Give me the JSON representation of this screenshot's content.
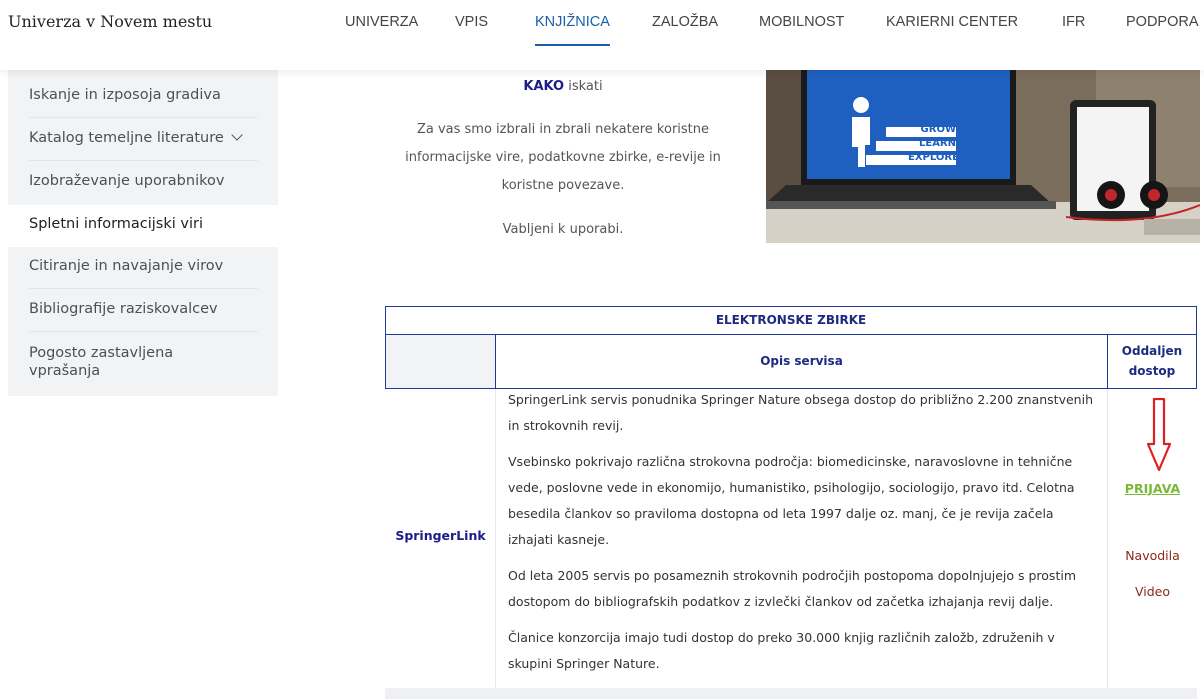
{
  "header": {
    "logo": "Univerza v Novem mestu",
    "nav": [
      {
        "label": "UNIVERZA"
      },
      {
        "label": "VPIS"
      },
      {
        "label": "KNJIŽNICA"
      },
      {
        "label": "ZALOŽBA"
      },
      {
        "label": "MOBILNOST"
      },
      {
        "label": "KARIERNI CENTER"
      },
      {
        "label": "IFR"
      },
      {
        "label": "PODPORA"
      }
    ],
    "active_nav": "KNJIŽNICA"
  },
  "sidebar": {
    "items": [
      {
        "label": "Iskanje in izposoja gradiva"
      },
      {
        "label": "Katalog temeljne literature"
      },
      {
        "label": "Izobraževanje uporabnikov"
      },
      {
        "label": "Spletni informacijski viri"
      },
      {
        "label": "Citiranje in navajanje virov"
      },
      {
        "label": "Bibliografije raziskovalcev"
      },
      {
        "label": "Pogosto zastavljena vprašanja"
      }
    ],
    "active_item": "Spletni informacijski viri"
  },
  "intro": {
    "kako_bold": "KAKO",
    "kako_rest": " iskati",
    "lines": [
      "Za vas smo izbrali in zbrali nekatere koristne",
      "informacijske vire, podatkovne zbirke, e-revije in",
      "koristne povezave."
    ],
    "welcome": "Vabljeni k uporabi."
  },
  "hero": {
    "text_lines": [
      "GROW",
      "LEARN",
      "EXPLORE"
    ]
  },
  "table": {
    "title": "ELEKTRONSKE ZBIRKE",
    "col_desc": "Opis servisa",
    "col_access_1": "Oddaljen",
    "col_access_2": "dostop",
    "row": {
      "name": "SpringerLink",
      "paragraphs": [
        [
          "SpringerLink servis ponudnika Springer Nature obsega dostop do približno 2.200 znanstvenih",
          "in strokovnih revij."
        ],
        [
          "Vsebinsko pokrivajo različna strokovna področja: biomedicinske, naravoslovne in tehnične",
          "vede, poslovne vede in ekonomijo, humanistiko, psihologijo, sociologijo, pravo itd. Celotna",
          "besedila člankov so praviloma dostopna od leta 1997 dalje oz. manj, če je revija začela",
          "izhajati kasneje."
        ],
        [
          "Od leta 2005 servis po posameznih strokovnih področjih postopoma dopolnjujejo s prostim",
          "dostopom do bibliografskih podatkov z izvlečki člankov od začetka izhajanja revij dalje."
        ],
        [
          "Članice konzorcija imajo tudi dostop do preko 30.000 knjig različnih založb, združenih v",
          "skupini Springer Nature."
        ]
      ],
      "login_link": "PRIJAVA",
      "guide_link": "Navodila",
      "video_link": "Video"
    }
  },
  "colors": {
    "nav_active": "#1a5fa8",
    "table_border": "#1f3a9a",
    "link_green": "#7ab83a",
    "link_red": "#8a2a1a",
    "arrow_red": "#e02020"
  }
}
